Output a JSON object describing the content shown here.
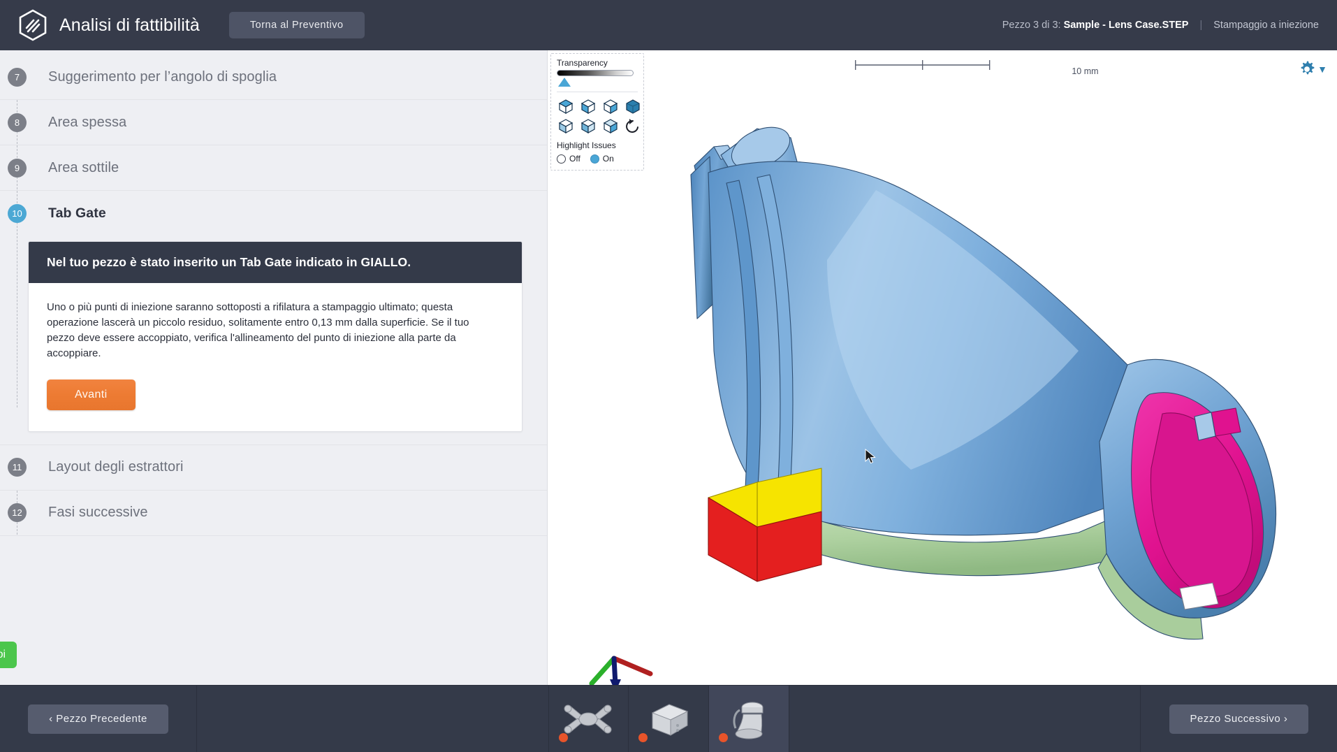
{
  "header": {
    "logo_icon": "hexagon-logo-icon",
    "title": "Analisi di fattibilità",
    "quote_button": "Torna al Preventivo",
    "part_counter_prefix": "Pezzo 3 di 3:",
    "part_name": "Sample - Lens Case.STEP",
    "separator": "|",
    "process": "Stampaggio a iniezione"
  },
  "sidebar": {
    "steps": [
      {
        "number": "7",
        "label": "Suggerimento per l’angolo di spoglia",
        "state": "done"
      },
      {
        "number": "8",
        "label": "Area spessa",
        "state": "done"
      },
      {
        "number": "9",
        "label": "Area sottile",
        "state": "done"
      },
      {
        "number": "10",
        "label": "Tab Gate",
        "state": "active"
      },
      {
        "number": "11",
        "label": "Layout degli estrattori",
        "state": "pending"
      },
      {
        "number": "12",
        "label": "Fasi successive",
        "state": "pending"
      }
    ],
    "card": {
      "heading": "Nel tuo pezzo è stato inserito un Tab Gate indicato in GIALLO.",
      "body": "Uno o più punti di iniezione saranno sottoposti a rifilatura a stampaggio ultimato; questa operazione lascerà un piccolo residuo, solitamente entro 0,13 mm dalla superficie. Se il tuo pezzo deve essere accoppiato, verifica l'allineamento del punto di iniezione alla parte da accoppiare.",
      "next_button": "Avanti"
    }
  },
  "viewport": {
    "controls": {
      "transparency_label": "Transparency",
      "highlight_label": "Highlight Issues",
      "radio_off": "Off",
      "radio_on": "On",
      "selected_radio": "On",
      "cube_icons": [
        "cube-view-top-icon",
        "cube-view-front-icon",
        "cube-view-left-icon",
        "cube-view-iso-icon",
        "cube-view-bottom-icon",
        "cube-view-back-icon",
        "cube-view-right-icon",
        "reset-view-icon"
      ]
    },
    "scale_label": "10 mm",
    "settings_icon": "gear-icon",
    "settings_caret": "▼",
    "axis_gizmo": {
      "x_color": "#b02020",
      "y_color": "#2bb02b",
      "z_color": "#101a6e"
    },
    "colors": {
      "part_blue": "#6ba3d6",
      "part_green": "#b6d5ab",
      "gate_yellow": "#f6e400",
      "gate_red": "#e41f1f",
      "interior_magenta": "#e5199a"
    }
  },
  "chat": {
    "label": "con noi"
  },
  "bottom_bar": {
    "prev_button": "‹ Pezzo Precedente",
    "next_button": "Pezzo Successivo ›",
    "thumbnails": [
      {
        "name": "part-thumbnail-bracket",
        "selected": false,
        "status": "issue"
      },
      {
        "name": "part-thumbnail-housing",
        "selected": false,
        "status": "issue"
      },
      {
        "name": "part-thumbnail-lenscase",
        "selected": true,
        "status": "issue"
      }
    ]
  }
}
